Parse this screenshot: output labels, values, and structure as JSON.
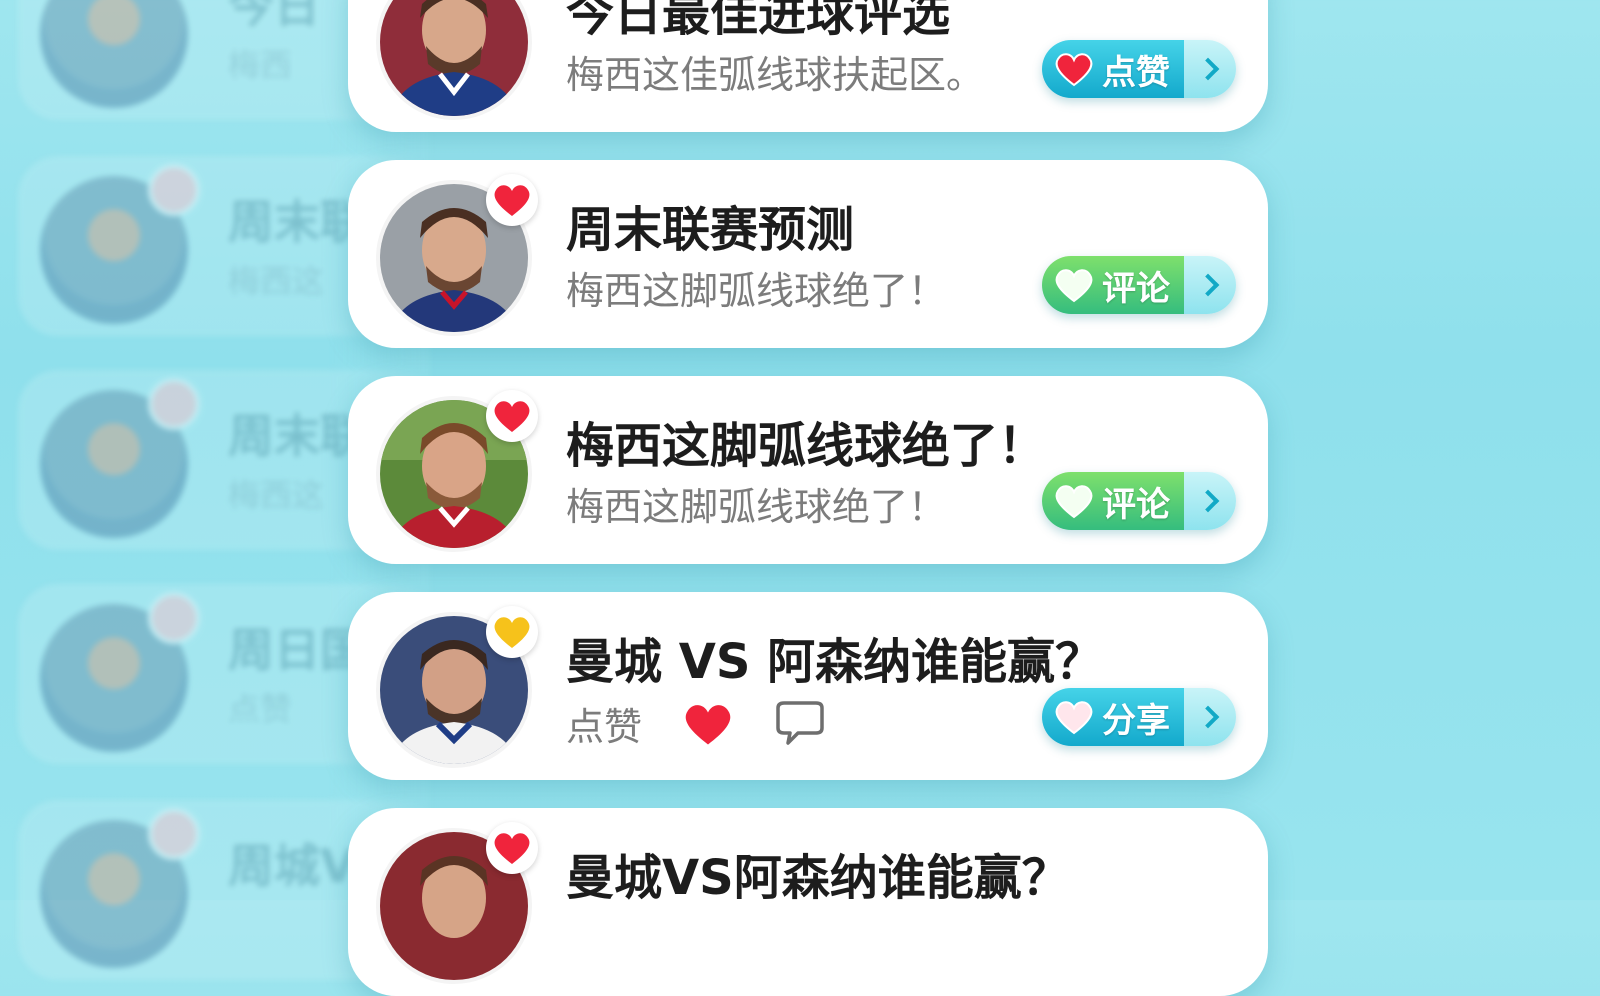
{
  "ghost_list": [
    {
      "title": "今日",
      "sub": "梅西"
    },
    {
      "title": "周末联",
      "sub": "梅西这"
    },
    {
      "title": "周末联",
      "sub": "梅西这"
    },
    {
      "title": "周日国",
      "sub": "点赞"
    },
    {
      "title": "周城V",
      "sub": ""
    }
  ],
  "cards": [
    {
      "title": "今日最佳进球评选",
      "subtitle": "梅西这佳弧线球扶起区。",
      "button": {
        "label": "点赞",
        "icon": "heart-icon"
      }
    },
    {
      "title": "周末联赛预测",
      "subtitle": "梅西这脚弧线球绝了！",
      "button": {
        "label": "评论",
        "icon": "heart-outline-icon"
      }
    },
    {
      "title": "梅西这脚弧线球绝了！",
      "subtitle": "梅西这脚弧线球绝了！",
      "button": {
        "label": "评论",
        "icon": "heart-outline-icon"
      }
    },
    {
      "title": "曼城 VS 阿森纳谁能赢？",
      "actions_label": "点赞",
      "button": {
        "label": "分享",
        "icon": "heart-outline-icon"
      }
    },
    {
      "title": "曼城VS阿森纳谁能赢？"
    }
  ],
  "colors": {
    "like_blue": "#1fb4d4",
    "comment_green": "#4cc96f",
    "heart_red": "#f0243c",
    "heart_yellow": "#f6c21b"
  }
}
